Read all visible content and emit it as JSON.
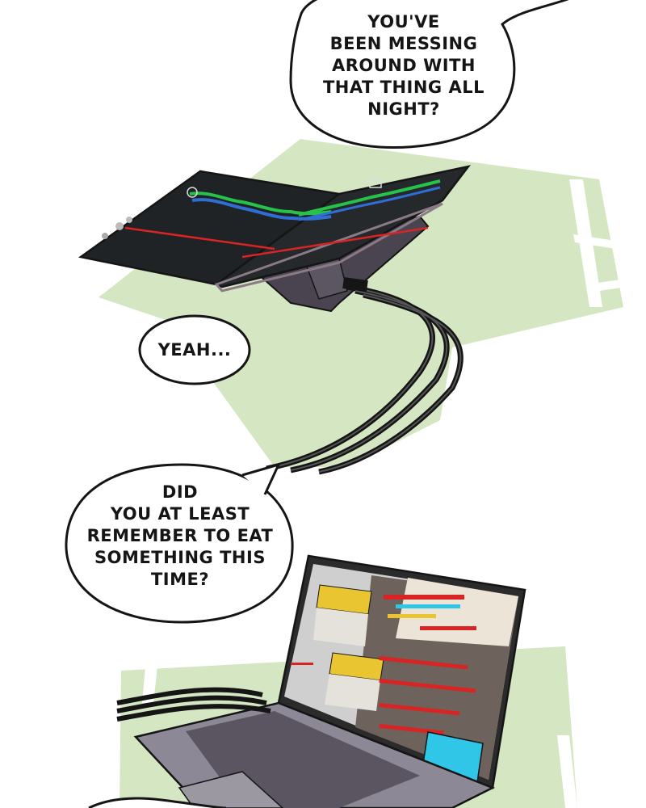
{
  "panels": [
    {
      "bubbles": [
        {
          "lines": [
            "YOU'VE",
            "BEEN MESSING",
            "AROUND WITH",
            "THAT THING ALL",
            "NIGHT?"
          ]
        },
        {
          "lines": [
            "YEAH..."
          ]
        }
      ]
    },
    {
      "bubbles": [
        {
          "lines": [
            "DID",
            "YOU AT LEAST",
            "REMEMBER TO EAT",
            "SOMETHING THIS",
            "TIME?"
          ]
        }
      ]
    }
  ],
  "colors": {
    "panel_bg": "#d4e6c2",
    "ink": "#151515",
    "device_screen": "#1f2325",
    "chart_green": "#27c24a",
    "chart_blue": "#2f6fd4",
    "chart_red": "#d82424",
    "laptop_body": "#8d8895",
    "accent_yellow": "#e9c531",
    "accent_cyan": "#2fc6e8"
  }
}
